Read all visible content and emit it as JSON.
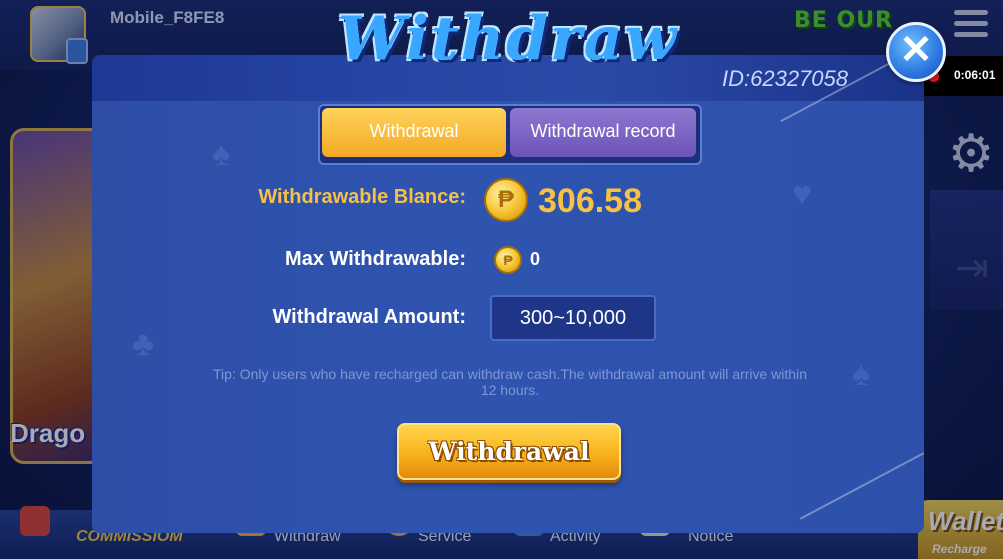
{
  "app": {
    "username": "Mobile_F8FE8",
    "promo_badge": "BE OUR"
  },
  "side_banner": {
    "label": "Drago"
  },
  "bottom_nav": {
    "items": [
      {
        "label": "COMMISSIOM",
        "icon": "commission-icon"
      },
      {
        "label": "Withdraw",
        "icon": "withdraw-icon"
      },
      {
        "label": "Service",
        "icon": "service-icon"
      },
      {
        "label": "Activity",
        "icon": "activity-icon"
      },
      {
        "label": "Notice",
        "icon": "notice-icon"
      }
    ],
    "wallet": {
      "title": "Wallet",
      "subtitle": "Recharge"
    }
  },
  "recording": {
    "time": "0:06:01"
  },
  "dialog": {
    "title": "Withdraw",
    "user_id": "ID:62327058",
    "close_icon": "close-icon",
    "tabs": [
      {
        "label": "Withdrawal",
        "active": true
      },
      {
        "label": "Withdrawal record",
        "active": false
      }
    ],
    "balance": {
      "label": "Withdrawable Blance:",
      "value": "306.58"
    },
    "max": {
      "label": "Max Withdrawable:",
      "value": "0"
    },
    "amount": {
      "label": "Withdrawal Amount:",
      "placeholder": "300~10,000"
    },
    "tip": "Tip: Only users who have recharged can withdraw cash.The withdrawal amount will arrive within 12 hours.",
    "submit_label": "Withdrawal"
  },
  "colors": {
    "accent": "#f5c04a",
    "panel": "#2f54b0",
    "button": "#f8b21c"
  }
}
